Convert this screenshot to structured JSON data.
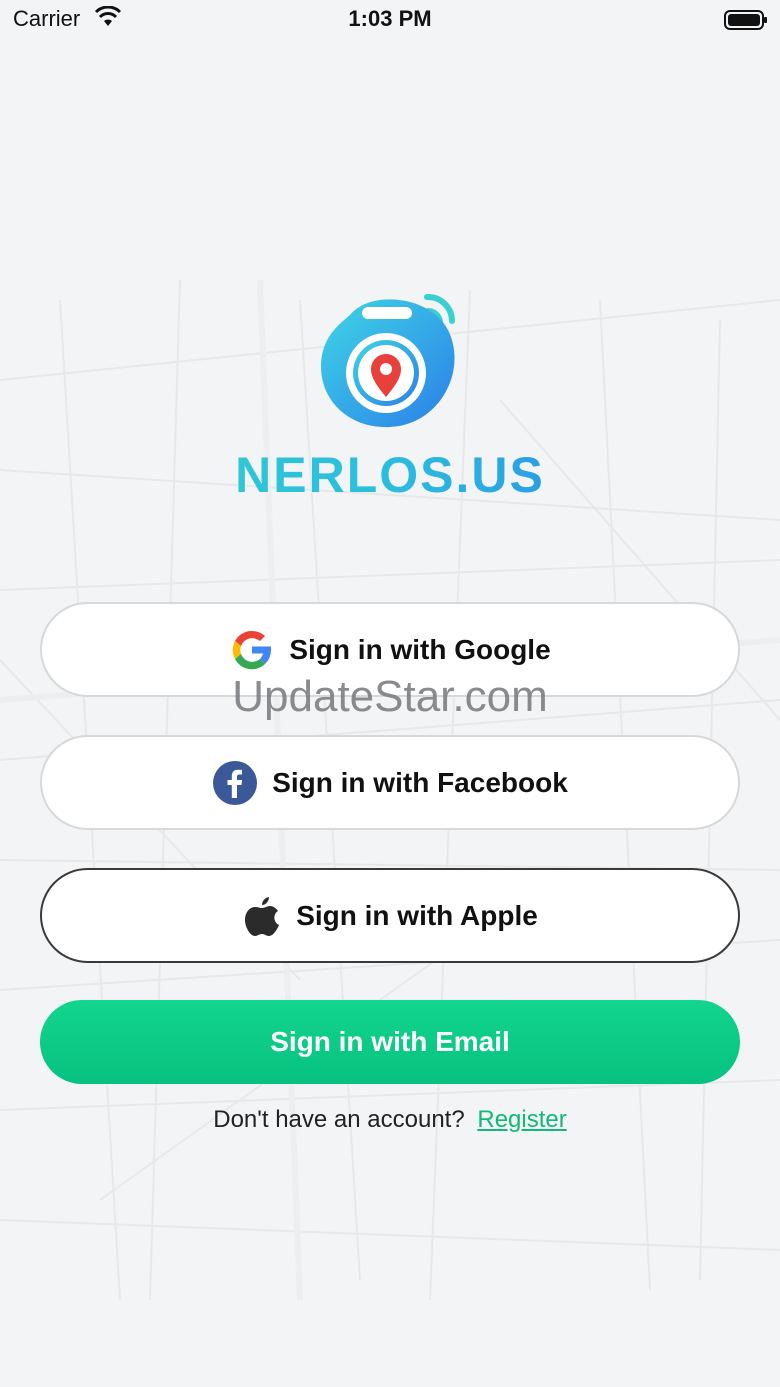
{
  "status_bar": {
    "carrier": "Carrier",
    "time": "1:03 PM",
    "wifi_icon": "wifi-icon",
    "battery_icon": "battery-icon"
  },
  "brand": {
    "name": "NERLOS.US",
    "logo_icon": "location-tracker-icon",
    "colors": {
      "teal": "#36d3c6",
      "blue": "#2a72e8",
      "pin_red": "#e8403a"
    }
  },
  "buttons": {
    "google": {
      "label": "Sign in with Google",
      "icon": "google-icon"
    },
    "facebook": {
      "label": "Sign in with Facebook",
      "icon": "facebook-icon"
    },
    "apple": {
      "label": "Sign in with Apple",
      "icon": "apple-icon"
    },
    "email": {
      "label": "Sign in with Email",
      "color": "#0fcf8a"
    }
  },
  "register": {
    "prompt": "Don't have an account?",
    "link": "Register",
    "link_color": "#12b877"
  },
  "watermark": "UpdateStar.com"
}
